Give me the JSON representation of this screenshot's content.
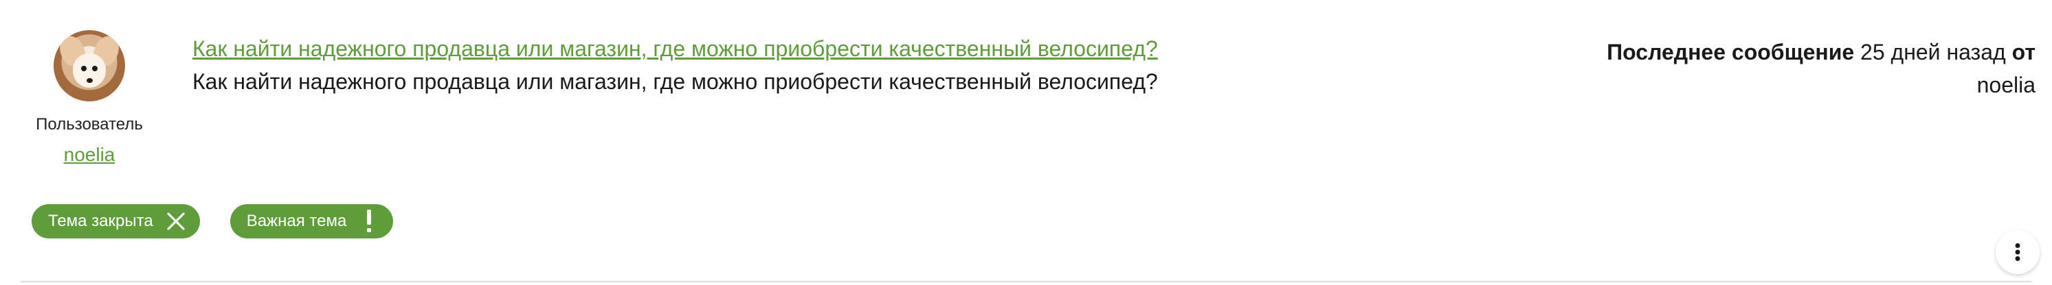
{
  "author": {
    "role": "Пользователь",
    "username": "noelia"
  },
  "topic": {
    "title": "Как найти надежного продавца или магазин, где можно приобрести качественный велосипед?",
    "snippet": "Как найти надежного продавца или магазин, где можно приобрести качественный велосипед?"
  },
  "last_post": {
    "label": "Последнее сообщение",
    "time": "25 дней назад",
    "from_label": "от",
    "username": "noelia"
  },
  "badges": [
    {
      "label": "Тема закрыта",
      "icon": "close-icon"
    },
    {
      "label": "Важная тема",
      "icon": "exclamation-icon"
    }
  ],
  "menu": {
    "icon": "more-vertical-icon"
  },
  "colors": {
    "accent": "#5f9c3a",
    "text": "#1a1a1a",
    "divider": "#dddddd"
  }
}
